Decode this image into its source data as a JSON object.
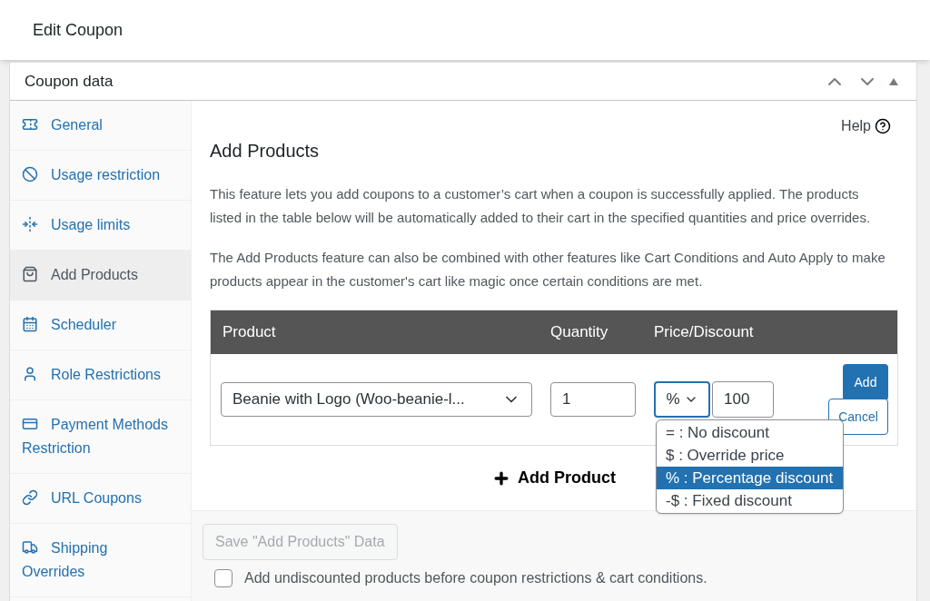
{
  "page_title": "Edit Coupon",
  "panel": {
    "title": "Coupon data",
    "controls": [
      {
        "kind": "up"
      },
      {
        "kind": "down"
      },
      {
        "kind": "toggle"
      }
    ]
  },
  "sidebar": {
    "items": [
      {
        "label": "General",
        "selected": false
      },
      {
        "label": "Usage restriction",
        "selected": false
      },
      {
        "label": "Usage limits",
        "selected": false
      },
      {
        "label": "Add Products",
        "selected": true
      },
      {
        "label": "Scheduler",
        "selected": false
      },
      {
        "label": "Role Restrictions",
        "selected": false
      },
      {
        "label": "Payment Methods Restriction",
        "selected": false
      },
      {
        "label": "URL Coupons",
        "selected": false
      },
      {
        "label": "Shipping Overrides",
        "selected": false
      }
    ]
  },
  "content": {
    "help": "Help",
    "heading": "Add Products",
    "paragraphs": [
      "This feature lets you add coupons to a customer’s cart when a coupon is successfully applied. The products listed in the table below will be automatically added to their cart in the specified quantities and price overrides.",
      "The Add Products feature can also be combined with other features like Cart Conditions and Auto Apply to make products appear in the customer's cart like magic once certain conditions are met."
    ],
    "table": {
      "columns": [
        "Product",
        "Quantity",
        "Price/Discount"
      ],
      "row": {
        "product": "Beanie with Logo (Woo-beanie-l...",
        "quantity": "1",
        "discount_type": "%",
        "amount": "100",
        "add": "Add",
        "cancel": "Cancel"
      }
    },
    "discount_options": [
      {
        "label": "= : No discount",
        "selected": false
      },
      {
        "label": "$ : Override price",
        "selected": false
      },
      {
        "label": "% : Percentage discount",
        "selected": true
      },
      {
        "label": "-$ : Fixed discount",
        "selected": false
      }
    ],
    "add_product": "Add Product"
  },
  "footer": {
    "save": {
      "label": "Save \"Add Products\" Data",
      "disabled": true
    },
    "checkbox": {
      "label": "Add undiscounted products before coupon restrictions & cart conditions.",
      "checked": false
    }
  }
}
